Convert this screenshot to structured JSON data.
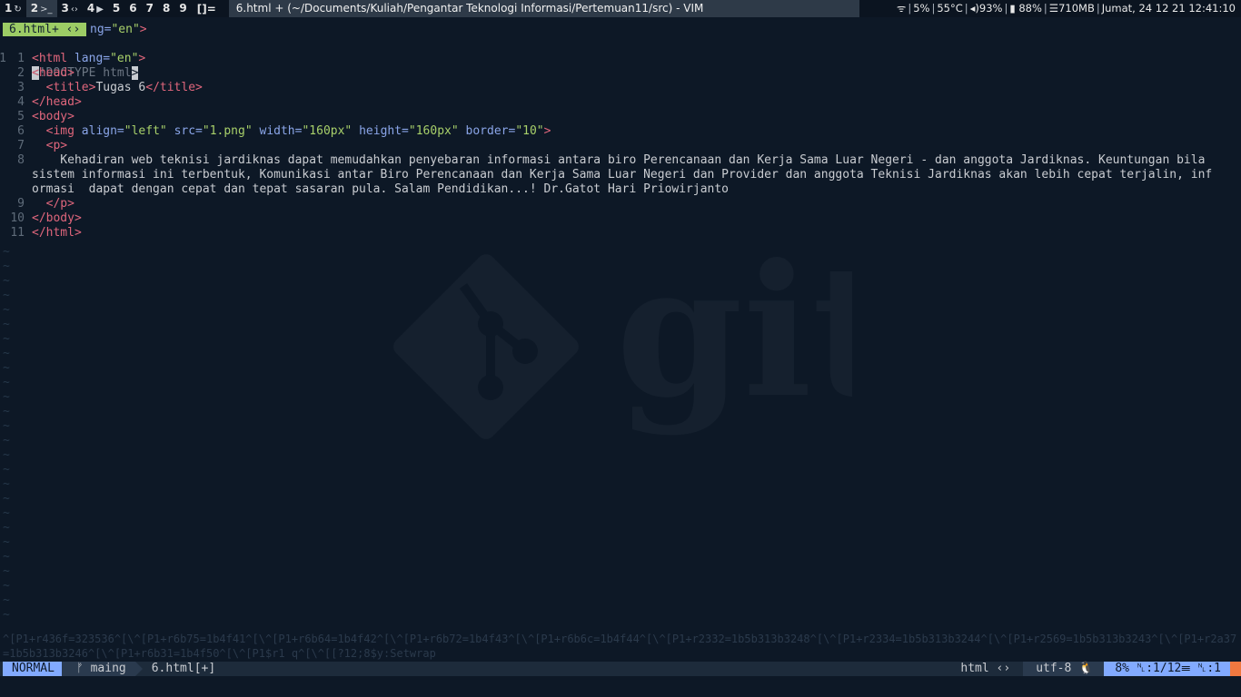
{
  "topbar": {
    "workspaces": [
      {
        "num": "1",
        "icon": "↻",
        "active": false
      },
      {
        "num": "2",
        "icon": ">_",
        "active": true
      },
      {
        "num": "3",
        "icon": "‹›",
        "active": false
      },
      {
        "num": "4",
        "icon": "▶",
        "active": false
      },
      {
        "num": "5",
        "icon": "",
        "active": false
      },
      {
        "num": "6",
        "icon": "",
        "active": false
      },
      {
        "num": "7",
        "icon": "",
        "active": false
      },
      {
        "num": "8",
        "icon": "",
        "active": false
      },
      {
        "num": "9",
        "icon": "",
        "active": false
      }
    ],
    "layout_symbol": "[]=",
    "window_title": "6.html + (~/Documents/Kuliah/Pengantar Teknologi Informasi/Pertemuan11/src) - VIM",
    "status": {
      "cpu": "5%",
      "temp": "55°C",
      "volume": "93%",
      "battery": "88%",
      "memory": "710MB",
      "datetime": "Jumat, 24 12 21 12:41:10"
    }
  },
  "editor": {
    "tab_label": "6.html+ ‹›",
    "tab_rest": "ng=\"en\">",
    "line1_num": "1",
    "line1": "!DOCTYPE html",
    "line1_lt": "<",
    "lines": [
      {
        "num": "1",
        "text": "<html lang=\"en\">"
      },
      {
        "num": "2",
        "text": "<head>"
      },
      {
        "num": "3",
        "text": "  <title>Tugas 6</title>"
      },
      {
        "num": "4",
        "text": "</head>"
      },
      {
        "num": "5",
        "text": "<body>"
      },
      {
        "num": "6",
        "text": "  <img align=\"left\" src=\"1.png\" width=\"160px\" height=\"160px\" border=\"10\">"
      },
      {
        "num": "7",
        "text": "  <p>"
      },
      {
        "num": "8",
        "text": "    Kehadiran web teknisi jardiknas dapat memudahkan penyebaran informasi antara biro Perencanaan dan Kerja Sama Luar Negeri - dan anggota Jardiknas. Keuntungan bila"
      },
      {
        "num": "",
        "text": "sistem informasi ini terbentuk, Komunikasi antar Biro Perencanaan dan Kerja Sama Luar Negeri dan Provider dan anggota Teknisi Jardiknas akan lebih cepat terjalin, inf"
      },
      {
        "num": "",
        "text": "ormasi  dapat dengan cepat dan tepat sasaran pula. Salam Pendidikan...! Dr.Gatot Hari Priowirjanto"
      },
      {
        "num": "9",
        "text": "  </p>"
      },
      {
        "num": "10",
        "text": "</body>"
      },
      {
        "num": "11",
        "text": "</html>"
      }
    ],
    "garbage_text": "^[P1+r436f=323536^[\\^[P1+r6b75=1b4f41^[\\^[P1+r6b64=1b4f42^[\\^[P1+r6b72=1b4f43^[\\^[P1+r6b6c=1b4f44^[\\^[P1+r2332=1b5b313b3248^[\\^[P1+r2334=1b5b313b3244^[\\^[P1+r2569=1b5b313b3243^[\\^[P1+r2a37=1b5b313b3246^[\\^[P1+r6b31=1b4f50^[\\^[P1$r1 q^[\\^[[?12;8$y:Setwrap"
  },
  "statusline": {
    "mode": "NORMAL",
    "branch": "ᚠ maing",
    "filename": "6.html[+]",
    "filetype": "html ‹›",
    "encoding": "utf-8 🐧",
    "position": "8% ␤:1/12☰ ␤:1"
  },
  "colors": {
    "background": "#0d1826",
    "tag": "#e0667c",
    "attribute": "#8aa5e8",
    "string": "#a8d06a",
    "mode_bg": "#82aaff",
    "tab_bg": "#9ccc65"
  }
}
